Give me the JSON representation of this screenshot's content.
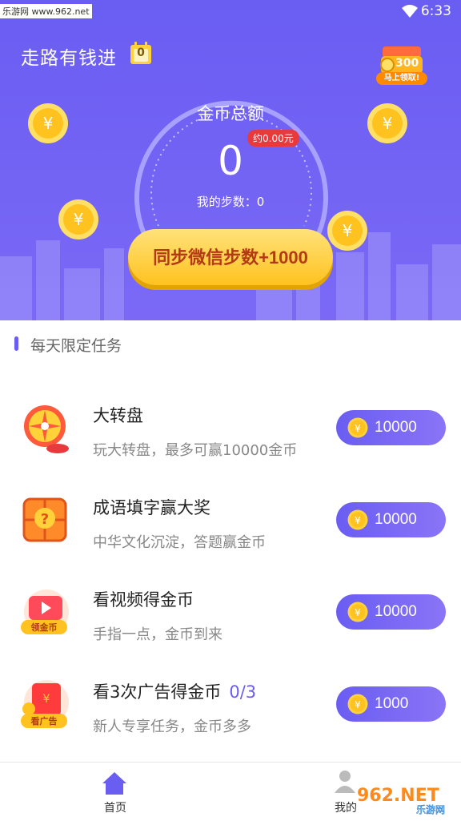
{
  "status_bar": {
    "time": "6:33",
    "watermark_text": "乐游网 www.962.net"
  },
  "header": {
    "title": "走路有钱进",
    "calendar_count": "0",
    "gift": {
      "amount": "300",
      "tag": "马上领取!"
    }
  },
  "gold": {
    "title": "金币总额",
    "value": "0",
    "approx": "约0.00元",
    "steps_label": "我的步数：0"
  },
  "sync_button": {
    "label": "同步微信步数+1000"
  },
  "tasks_section": {
    "title": "每天限定任务"
  },
  "tasks": [
    {
      "title": "大转盘",
      "progress": "",
      "desc": "玩大转盘，最多可赢10000金币",
      "reward": "10000",
      "icon": "wheel-icon"
    },
    {
      "title": "成语填字赢大奖",
      "progress": "",
      "desc": "中华文化沉淀，答题赢金币",
      "reward": "10000",
      "icon": "quiz-icon"
    },
    {
      "title": "看视频得金币",
      "progress": "",
      "desc": "手指一点，金币到来",
      "reward": "10000",
      "icon": "video-icon",
      "badge": "领金币"
    },
    {
      "title": "看3次广告得金币",
      "progress": "0/3",
      "desc": "新人专享任务，金币多多",
      "reward": "1000",
      "icon": "ad-icon",
      "badge": "看广告"
    }
  ],
  "bottom_nav": [
    {
      "label": "首页",
      "icon": "home-icon",
      "active": true
    },
    {
      "label": "我的",
      "icon": "profile-icon",
      "active": false
    }
  ],
  "corner_watermark": {
    "text": "962.NET",
    "sub": "乐游网"
  },
  "colors": {
    "primary": "#6a5df2",
    "accent_gold": "#ffc21f",
    "badge_red": "#e8393c"
  }
}
